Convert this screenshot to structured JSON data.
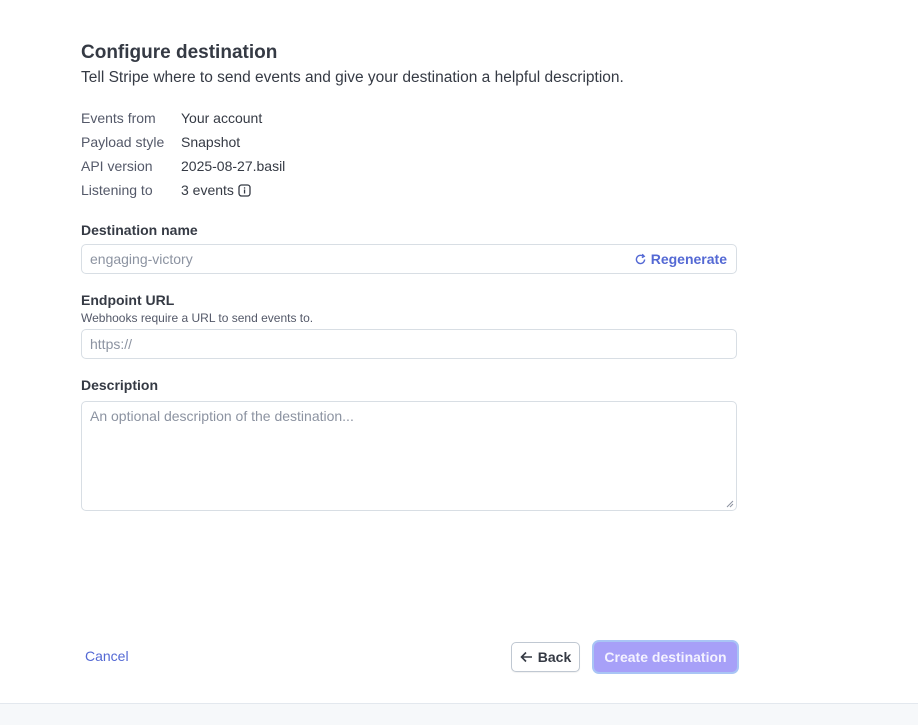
{
  "header": {
    "title": "Configure destination",
    "subtitle": "Tell Stripe where to send events and give your destination a helpful description."
  },
  "meta": [
    {
      "label": "Events from",
      "value": "Your account"
    },
    {
      "label": "Payload style",
      "value": "Snapshot"
    },
    {
      "label": "API version",
      "value": "2025-08-27.basil"
    },
    {
      "label": "Listening to",
      "value": "3 events"
    }
  ],
  "destination_name": {
    "label": "Destination name",
    "value": "engaging-victory",
    "regenerate_label": "Regenerate"
  },
  "endpoint_url": {
    "label": "Endpoint URL",
    "help": "Webhooks require a URL to send events to.",
    "placeholder": "https://"
  },
  "description": {
    "label": "Description",
    "placeholder": "An optional description of the destination..."
  },
  "footer": {
    "cancel_label": "Cancel",
    "back_label": "Back",
    "create_label": "Create destination"
  },
  "colors": {
    "accent": "#5469d4",
    "create_button_disabled": "#a7a0f8",
    "text_primary": "#353a44"
  }
}
